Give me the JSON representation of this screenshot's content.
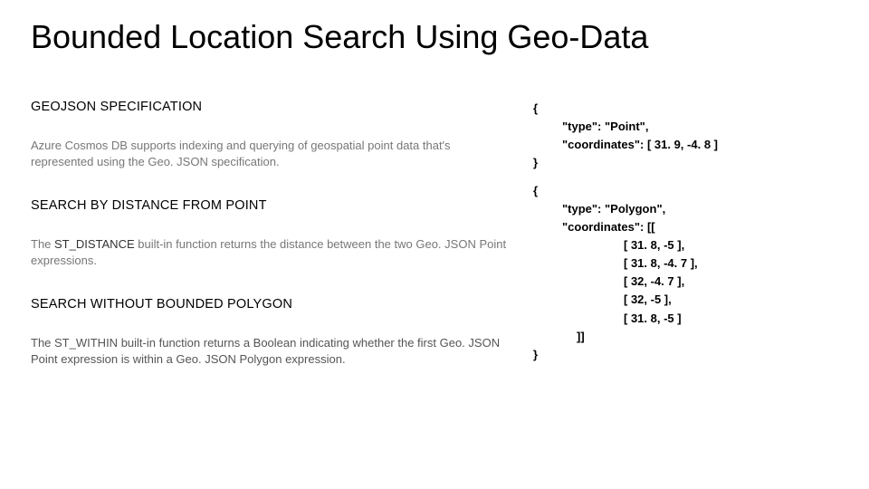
{
  "title": "Bounded Location Search Using Geo-Data",
  "left": {
    "sec1": {
      "heading": "GEOJSON SPECIFICATION",
      "body": "Azure Cosmos DB supports indexing and querying of geospatial point data that's represented using the Geo. JSON specification."
    },
    "sec2": {
      "heading": "SEARCH BY DISTANCE FROM POINT",
      "body_pre": "The ",
      "kw": "ST_DISTANCE",
      "body_post": " built-in function returns the distance between the two Geo. JSON Point expressions."
    },
    "sec3": {
      "heading": "SEARCH WITHOUT BOUNDED POLYGON",
      "body_pre": "The ",
      "kw": "ST_WITHIN",
      "body_post": " built-in function returns a Boolean indicating whether the first Geo. JSON Point expression is within a Geo. JSON Polygon expression."
    }
  },
  "code": {
    "l0": "{",
    "l1": "\"type\": \"Point\",",
    "l2": "\"coordinates\": [ 31. 9, -4. 8 ]",
    "l3": "}",
    "l4": "{",
    "l5": "\"type\": \"Polygon\",",
    "l6": "\"coordinates\": [[",
    "l7": "[ 31. 8, -5 ],",
    "l8": "[ 31. 8, -4. 7 ],",
    "l9": "[ 32, -4. 7 ],",
    "l10": "[ 32, -5 ],",
    "l11": "[ 31. 8, -5 ]",
    "l12": "]]",
    "l13": "}"
  }
}
